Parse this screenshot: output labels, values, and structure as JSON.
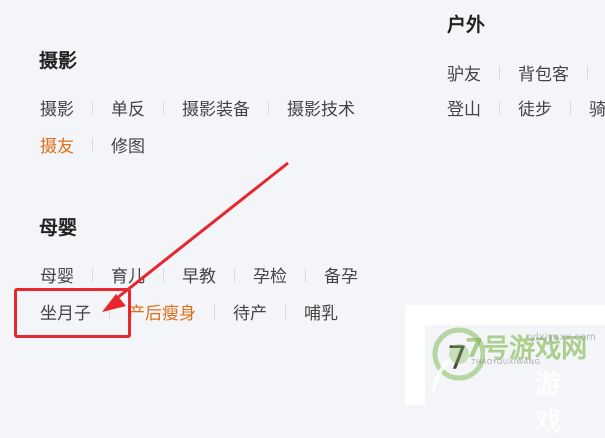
{
  "sections": {
    "outdoor": {
      "title": "户外",
      "row1": [
        "驴友",
        "背包客",
        ""
      ],
      "row2": [
        "登山",
        "徒步",
        "骑"
      ]
    },
    "photo": {
      "title": "摄影",
      "row1": [
        "摄影",
        "单反",
        "摄影装备",
        "摄影技术"
      ],
      "row2": [
        "摄友",
        "修图"
      ]
    },
    "baby": {
      "title": "母婴",
      "row1": [
        "母婴",
        "育儿",
        "早教",
        "孕检",
        "备孕"
      ],
      "row2": [
        "坐月子",
        "产后瘦身",
        "待产",
        "哺乳"
      ]
    }
  },
  "panel": {
    "text": "7"
  },
  "watermark": {
    "main": "7号游戏网",
    "sub": "7HAOYOUXIWANG",
    "site": "ylxjyaxx.com",
    "game": "游戏"
  },
  "colors": {
    "highlight": "#e0701a",
    "annotation": "#e8262d",
    "background": "#f3f5f8"
  }
}
